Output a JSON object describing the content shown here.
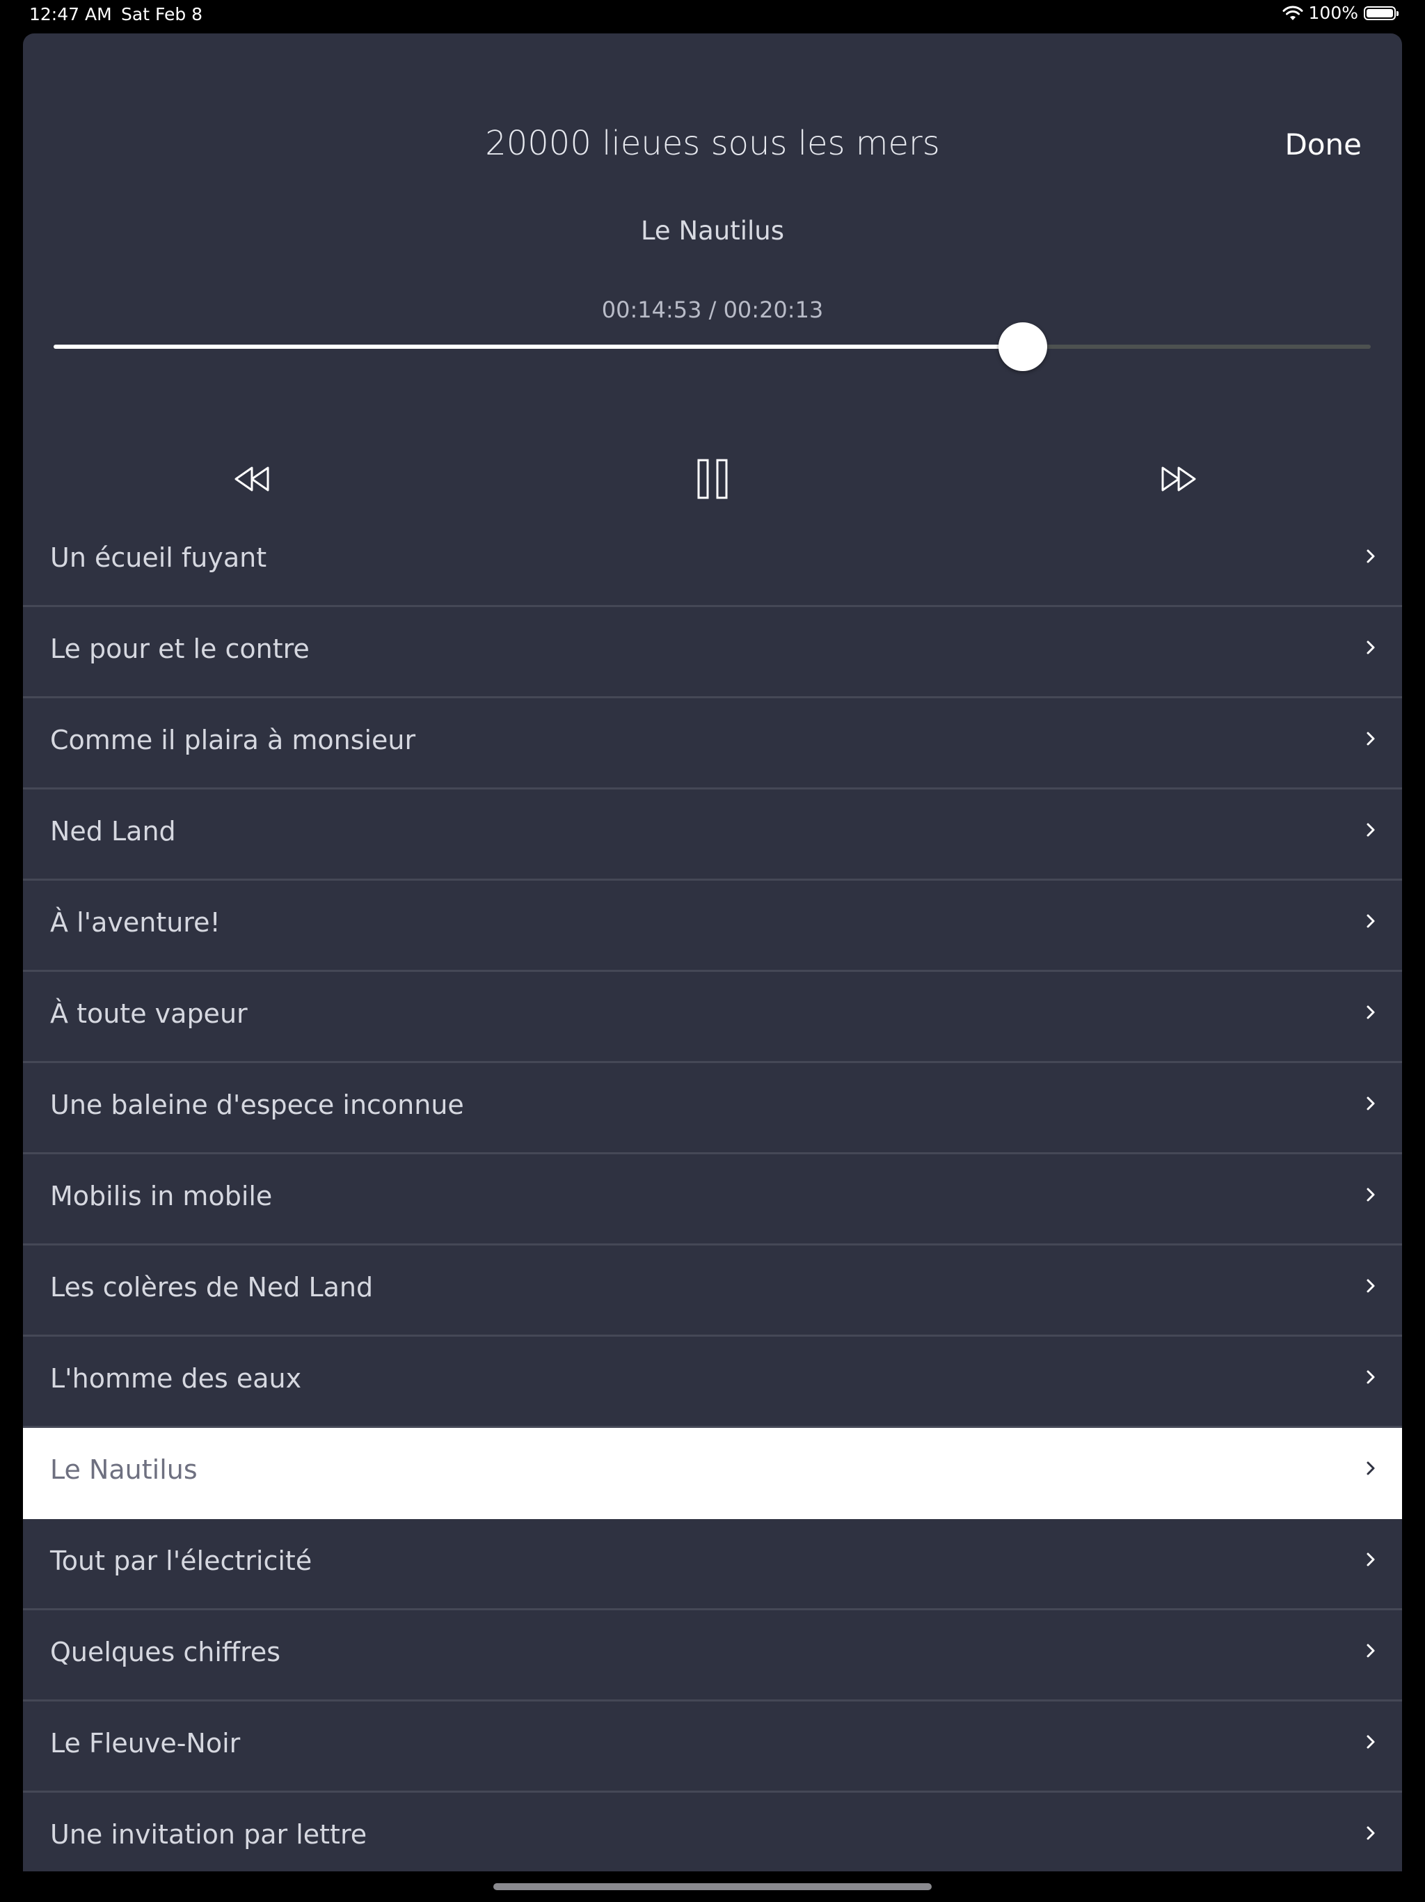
{
  "status_bar": {
    "time": "12:47 AM",
    "date": "Sat Feb 8",
    "battery_percent": "100%",
    "icons": [
      "wifi-icon",
      "battery-icon"
    ]
  },
  "player": {
    "book_title": "20000 lieues sous les mers",
    "done_label": "Done",
    "chapter_title": "Le Nautilus",
    "time_readout": "00:14:53 / 00:20:13",
    "progress_fraction": 0.7357,
    "controls": [
      "rewind-icon",
      "pause-icon",
      "fast-forward-icon"
    ]
  },
  "chapters": {
    "active_index": 10,
    "items": [
      {
        "label": "Un écueil fuyant"
      },
      {
        "label": "Le pour et le contre"
      },
      {
        "label": "Comme il plaira à monsieur"
      },
      {
        "label": "Ned Land"
      },
      {
        "label": "À l'aventure!"
      },
      {
        "label": "À toute vapeur"
      },
      {
        "label": "Une baleine d'espece inconnue"
      },
      {
        "label": "Mobilis in mobile"
      },
      {
        "label": "Les colères de Ned Land"
      },
      {
        "label": "L'homme des eaux"
      },
      {
        "label": "Le Nautilus"
      },
      {
        "label": "Tout par l'électricité"
      },
      {
        "label": "Quelques chiffres"
      },
      {
        "label": "Le Fleuve-Noir"
      },
      {
        "label": "Une invitation par lettre"
      },
      {
        "label": ""
      }
    ]
  },
  "colors": {
    "sheet_background": "#2f3241",
    "active_row_background": "#ffffff",
    "divider": "#454856"
  }
}
